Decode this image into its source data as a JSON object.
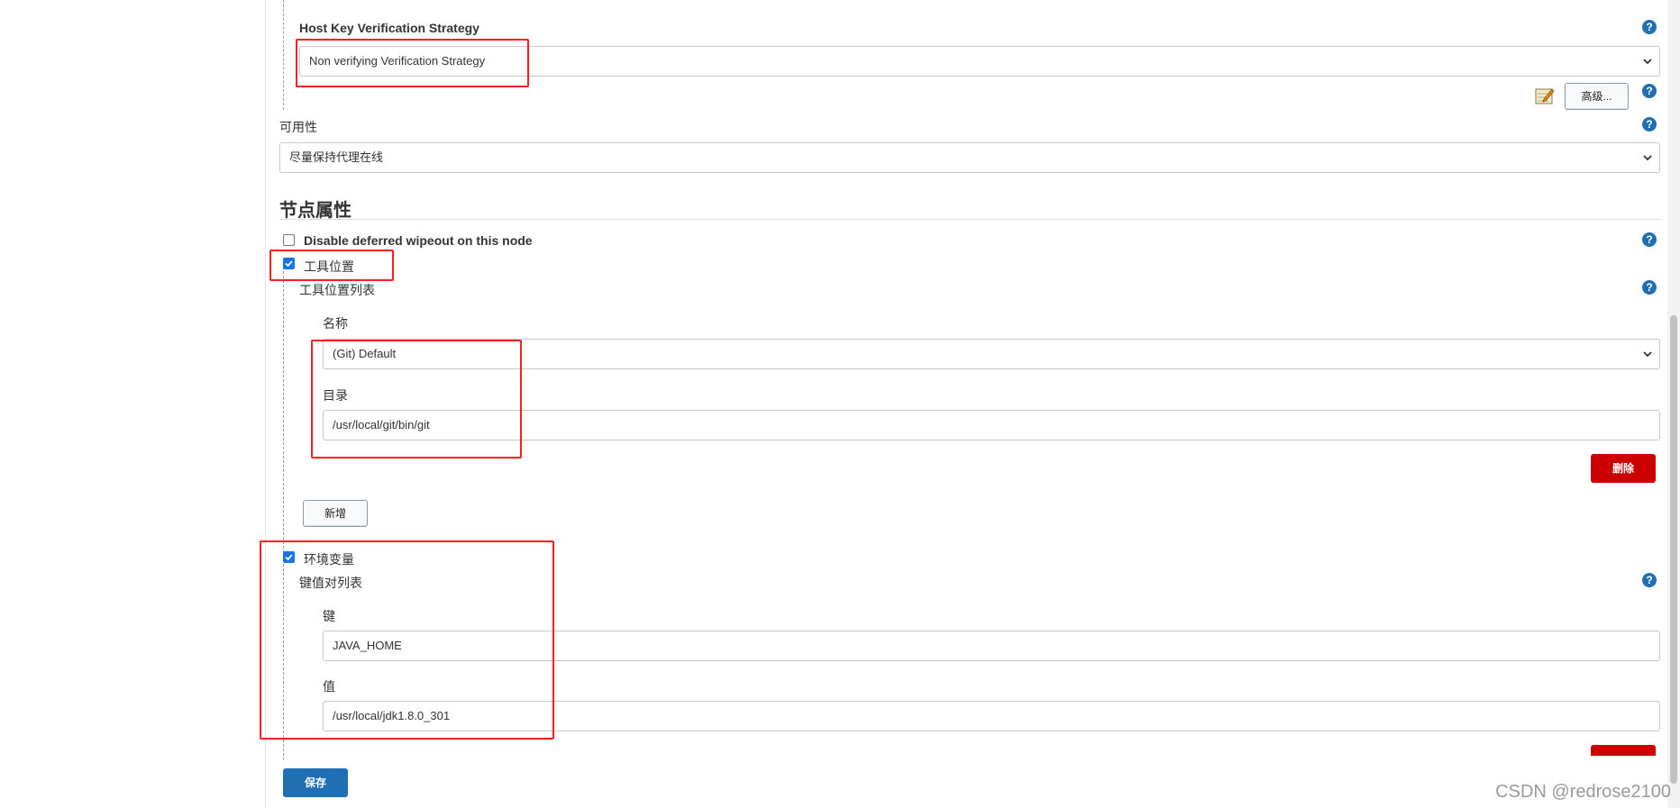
{
  "host_key": {
    "label": "Host Key Verification Strategy",
    "selected": "Non verifying Verification Strategy"
  },
  "advanced_button": "高级...",
  "availability": {
    "label": "可用性",
    "selected": "尽量保持代理在线"
  },
  "node_properties": {
    "title": "节点属性",
    "disable_wipeout": {
      "label": "Disable deferred wipeout on this node",
      "checked": false
    },
    "tool_locations": {
      "label": "工具位置",
      "checked": true,
      "list_label": "工具位置列表",
      "name_label": "名称",
      "name_selected": "(Git) Default",
      "dir_label": "目录",
      "dir_value": "/usr/local/git/bin/git",
      "delete_button": "删除",
      "add_button": "新增"
    },
    "env_vars": {
      "label": "环境变量",
      "checked": true,
      "list_label": "键值对列表",
      "key_label": "键",
      "key_value": "JAVA_HOME",
      "value_label": "值",
      "value_value": "/usr/local/jdk1.8.0_301"
    }
  },
  "save_button": "保存",
  "help_glyph": "?",
  "watermark": "CSDN @redrose2100",
  "colors": {
    "primary": "#1f6fb2",
    "danger": "#cc0000",
    "highlight_box": "#ff1e1e",
    "checkbox": "#1a73e8"
  }
}
